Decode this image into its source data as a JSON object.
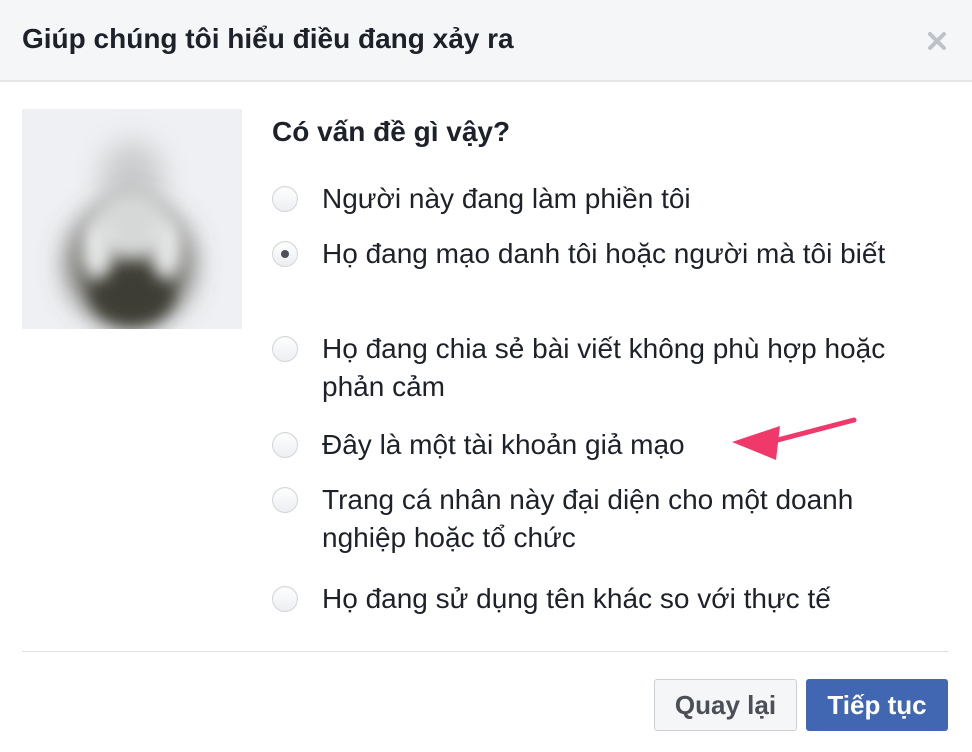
{
  "dialog": {
    "title": "Giúp chúng tôi hiểu điều đang xảy ra",
    "close_icon": "close-icon"
  },
  "avatar": {
    "description_icon": "blurred-profile-photo"
  },
  "question": "Có vấn đề gì vậy?",
  "options": [
    {
      "label": "Người này đang làm phiền tôi",
      "checked": false
    },
    {
      "label": "Họ đang mạo danh tôi hoặc người mà tôi biết",
      "checked": true
    },
    {
      "label": "Họ đang chia sẻ bài viết không phù hợp hoặc phản cảm",
      "checked": false
    },
    {
      "label": "Đây là một tài khoản giả mạo",
      "checked": false
    },
    {
      "label": "Trang cá nhân này đại diện cho một doanh nghiệp hoặc tổ chức",
      "checked": false
    },
    {
      "label": "Họ đang sử dụng tên khác so với thực tế",
      "checked": false
    }
  ],
  "buttons": {
    "back_label": "Quay lại",
    "continue_label": "Tiếp tục"
  },
  "annotation": {
    "arrow_icon": "pink-arrow-icon",
    "arrow_color": "#f0386b"
  },
  "colors": {
    "primary": "#4267b2",
    "header_bg": "#f5f6f7",
    "text": "#1d2129"
  }
}
